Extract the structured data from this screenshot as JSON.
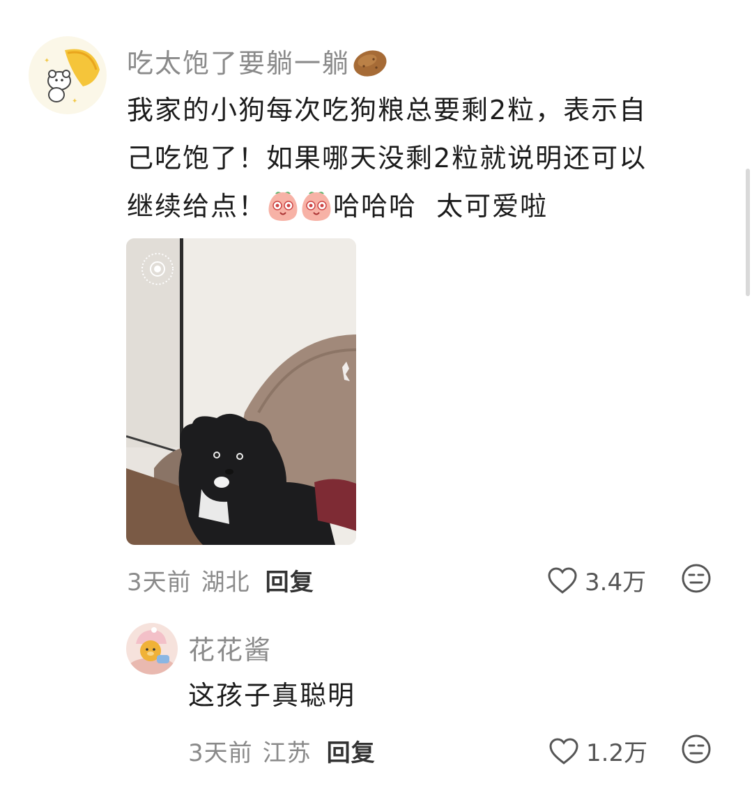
{
  "comment": {
    "username": "吃太饱了要躺一躺",
    "username_emoji": "potato-emoji",
    "text_lines": [
      "我家的小狗每次吃狗粮总要剩2粒，表示自",
      "己吃饱了！如果哪天没剩2粒就说明还可以",
      "继续给点！"
    ],
    "text_tail": "哈哈哈  太可爱啦",
    "time": "3天前",
    "location": "湖北",
    "reply_label": "回复",
    "likes": "3.4万"
  },
  "reply": {
    "username": "花花酱",
    "text": "这孩子真聪明",
    "time": "3天前",
    "location": "江苏",
    "reply_label": "回复",
    "likes": "1.2万"
  }
}
